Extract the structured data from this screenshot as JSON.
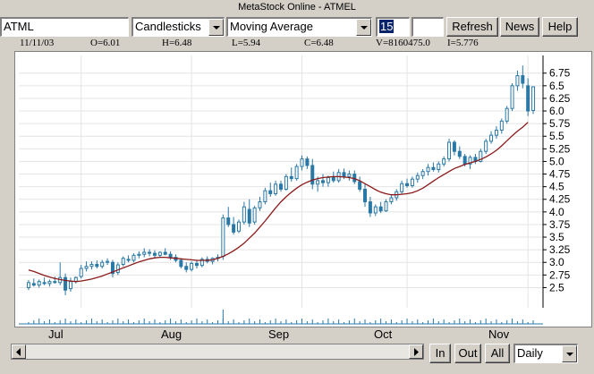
{
  "window": {
    "title": "MetaStock Online - ATMEL"
  },
  "toolbar": {
    "symbol": "ATML",
    "chart_type": "Candlesticks",
    "indicator": "Moving Average",
    "period": "15",
    "extra": "",
    "refresh_label": "Refresh",
    "news_label": "News",
    "help_label": "Help"
  },
  "info": {
    "date": "11/11/03",
    "open": "O=6.01",
    "high": "H=6.48",
    "low": "L=5.94",
    "close": "C=6.48",
    "volume": "V=8160475.0",
    "indicator": "I=5.776"
  },
  "bottom": {
    "in_label": "In",
    "out_label": "Out",
    "all_label": "All",
    "interval": "Daily"
  },
  "colors": {
    "up": "#2a78a6",
    "down": "#ffffff",
    "ma": "#8b1a1a",
    "grid": "#e4e4e4"
  },
  "chart_data": {
    "type": "candlestick",
    "title": "",
    "xlabel": "",
    "ylabel": "",
    "ylim": [
      2.1,
      7.1
    ],
    "y_ticks": [
      2.5,
      2.75,
      3.0,
      3.25,
      3.5,
      3.75,
      4.0,
      4.25,
      4.5,
      4.75,
      5.0,
      5.25,
      5.5,
      5.75,
      6.0,
      6.25,
      6.5,
      6.75
    ],
    "y_tick_labels": [
      "2.5",
      "2.75",
      "3.0",
      "3.25",
      "3.5",
      "3.75",
      "4.0",
      "4.25",
      "4.5",
      "4.75",
      "5.0",
      "5.25",
      "5.5",
      "5.75",
      "6.0",
      "6.25",
      "6.5",
      "6.75"
    ],
    "x_tick_labels": [
      {
        "label": "Jul",
        "index": 10
      },
      {
        "label": "Aug",
        "index": 31
      },
      {
        "label": "Sep",
        "index": 52
      },
      {
        "label": "Oct",
        "index": 72
      },
      {
        "label": "Nov",
        "index": 95
      }
    ],
    "ohlc": [
      [
        2.5,
        2.65,
        2.45,
        2.6
      ],
      [
        2.58,
        2.68,
        2.52,
        2.55
      ],
      [
        2.55,
        2.66,
        2.5,
        2.62
      ],
      [
        2.6,
        2.7,
        2.55,
        2.58
      ],
      [
        2.58,
        2.66,
        2.52,
        2.62
      ],
      [
        2.62,
        2.72,
        2.58,
        2.6
      ],
      [
        2.6,
        3.0,
        2.55,
        2.7
      ],
      [
        2.7,
        2.78,
        2.35,
        2.45
      ],
      [
        2.48,
        2.7,
        2.42,
        2.62
      ],
      [
        2.62,
        2.72,
        2.58,
        2.7
      ],
      [
        2.72,
        2.95,
        2.68,
        2.88
      ],
      [
        2.88,
        3.02,
        2.82,
        2.92
      ],
      [
        2.92,
        3.02,
        2.86,
        2.96
      ],
      [
        2.96,
        3.04,
        2.88,
        2.92
      ],
      [
        2.92,
        3.05,
        2.88,
        3.0
      ],
      [
        3.0,
        3.08,
        2.95,
        3.02
      ],
      [
        3.0,
        3.05,
        2.7,
        2.78
      ],
      [
        2.8,
        3.0,
        2.75,
        2.95
      ],
      [
        2.96,
        3.12,
        2.92,
        3.08
      ],
      [
        3.06,
        3.14,
        3.0,
        3.04
      ],
      [
        3.04,
        3.18,
        3.0,
        3.14
      ],
      [
        3.14,
        3.22,
        3.08,
        3.16
      ],
      [
        3.16,
        3.28,
        3.1,
        3.2
      ],
      [
        3.2,
        3.26,
        3.12,
        3.18
      ],
      [
        3.18,
        3.24,
        3.08,
        3.14
      ],
      [
        3.14,
        3.22,
        3.1,
        3.2
      ],
      [
        3.2,
        3.28,
        3.14,
        3.16
      ],
      [
        3.16,
        3.22,
        3.05,
        3.1
      ],
      [
        3.1,
        3.16,
        3.0,
        3.04
      ],
      [
        3.04,
        3.08,
        2.88,
        2.92
      ],
      [
        2.92,
        3.0,
        2.8,
        2.86
      ],
      [
        2.86,
        3.02,
        2.82,
        2.98
      ],
      [
        2.98,
        3.05,
        2.88,
        2.94
      ],
      [
        2.94,
        3.1,
        2.9,
        3.06
      ],
      [
        3.06,
        3.12,
        2.98,
        3.02
      ],
      [
        3.02,
        3.1,
        2.96,
        3.08
      ],
      [
        3.08,
        3.16,
        3.02,
        3.1
      ],
      [
        3.12,
        3.95,
        3.05,
        3.88
      ],
      [
        3.88,
        4.1,
        3.7,
        3.75
      ],
      [
        3.75,
        3.9,
        3.55,
        3.6
      ],
      [
        3.62,
        3.85,
        3.58,
        3.8
      ],
      [
        3.8,
        4.2,
        3.75,
        4.1
      ],
      [
        4.05,
        4.25,
        3.7,
        3.78
      ],
      [
        3.8,
        4.12,
        3.75,
        4.08
      ],
      [
        4.08,
        4.3,
        4.02,
        4.2
      ],
      [
        4.2,
        4.48,
        4.15,
        4.42
      ],
      [
        4.42,
        4.58,
        4.3,
        4.36
      ],
      [
        4.36,
        4.62,
        4.32,
        4.55
      ],
      [
        4.55,
        4.62,
        4.4,
        4.45
      ],
      [
        4.45,
        4.75,
        4.42,
        4.7
      ],
      [
        4.7,
        4.88,
        4.6,
        4.66
      ],
      [
        4.66,
        4.95,
        4.62,
        4.9
      ],
      [
        4.9,
        5.12,
        4.82,
        5.05
      ],
      [
        5.05,
        5.1,
        4.85,
        4.92
      ],
      [
        4.92,
        5.05,
        4.45,
        4.55
      ],
      [
        4.55,
        4.7,
        4.4,
        4.62
      ],
      [
        4.62,
        4.75,
        4.5,
        4.58
      ],
      [
        4.58,
        4.72,
        4.5,
        4.68
      ],
      [
        4.68,
        4.8,
        4.58,
        4.62
      ],
      [
        4.62,
        4.85,
        4.58,
        4.78
      ],
      [
        4.78,
        4.86,
        4.65,
        4.7
      ],
      [
        4.7,
        4.82,
        4.62,
        4.75
      ],
      [
        4.75,
        4.82,
        4.55,
        4.6
      ],
      [
        4.6,
        4.7,
        4.4,
        4.45
      ],
      [
        4.45,
        4.55,
        4.1,
        4.2
      ],
      [
        4.2,
        4.3,
        3.9,
        3.98
      ],
      [
        3.98,
        4.15,
        3.92,
        4.1
      ],
      [
        4.1,
        4.2,
        3.98,
        4.02
      ],
      [
        4.02,
        4.25,
        4.0,
        4.2
      ],
      [
        4.2,
        4.35,
        4.15,
        4.28
      ],
      [
        4.28,
        4.45,
        4.22,
        4.4
      ],
      [
        4.4,
        4.62,
        4.35,
        4.56
      ],
      [
        4.56,
        4.66,
        4.48,
        4.52
      ],
      [
        4.52,
        4.7,
        4.48,
        4.65
      ],
      [
        4.65,
        4.78,
        4.58,
        4.72
      ],
      [
        4.72,
        4.85,
        4.65,
        4.8
      ],
      [
        4.8,
        4.95,
        4.72,
        4.88
      ],
      [
        4.88,
        4.98,
        4.8,
        4.84
      ],
      [
        4.84,
        5.0,
        4.78,
        4.95
      ],
      [
        4.95,
        5.1,
        4.9,
        5.05
      ],
      [
        5.05,
        5.45,
        5.0,
        5.38
      ],
      [
        5.38,
        5.42,
        5.12,
        5.2
      ],
      [
        5.2,
        5.3,
        5.05,
        5.1
      ],
      [
        5.1,
        5.15,
        4.9,
        4.95
      ],
      [
        4.95,
        5.12,
        4.85,
        5.08
      ],
      [
        5.08,
        5.15,
        4.95,
        5.0
      ],
      [
        5.0,
        5.25,
        4.98,
        5.2
      ],
      [
        5.2,
        5.45,
        5.15,
        5.4
      ],
      [
        5.4,
        5.6,
        5.35,
        5.52
      ],
      [
        5.52,
        5.7,
        5.45,
        5.62
      ],
      [
        5.62,
        5.85,
        5.55,
        5.8
      ],
      [
        5.8,
        6.1,
        5.75,
        6.05
      ],
      [
        6.05,
        6.55,
        6.0,
        6.5
      ],
      [
        6.5,
        6.8,
        6.4,
        6.7
      ],
      [
        6.7,
        6.9,
        6.45,
        6.55
      ],
      [
        6.5,
        6.65,
        5.9,
        6.0
      ],
      [
        6.01,
        6.48,
        5.94,
        6.48
      ]
    ],
    "ma": [
      2.85,
      2.82,
      2.78,
      2.74,
      2.71,
      2.68,
      2.66,
      2.64,
      2.63,
      2.62,
      2.63,
      2.65,
      2.67,
      2.7,
      2.73,
      2.77,
      2.81,
      2.85,
      2.89,
      2.93,
      2.97,
      3.01,
      3.04,
      3.07,
      3.09,
      3.1,
      3.1,
      3.09,
      3.08,
      3.07,
      3.06,
      3.05,
      3.04,
      3.04,
      3.04,
      3.05,
      3.08,
      3.12,
      3.17,
      3.23,
      3.3,
      3.38,
      3.48,
      3.58,
      3.7,
      3.82,
      3.95,
      4.08,
      4.2,
      4.3,
      4.39,
      4.47,
      4.54,
      4.59,
      4.63,
      4.66,
      4.68,
      4.69,
      4.7,
      4.7,
      4.69,
      4.68,
      4.66,
      4.62,
      4.56,
      4.5,
      4.44,
      4.39,
      4.36,
      4.34,
      4.34,
      4.35,
      4.36,
      4.38,
      4.42,
      4.47,
      4.54,
      4.61,
      4.68,
      4.74,
      4.8,
      4.86,
      4.9,
      4.94,
      4.97,
      5.0,
      5.04,
      5.09,
      5.15,
      5.22,
      5.31,
      5.41,
      5.51,
      5.6,
      5.68,
      5.776
    ],
    "volume_hint": "volume ticks at bottom of chart"
  }
}
